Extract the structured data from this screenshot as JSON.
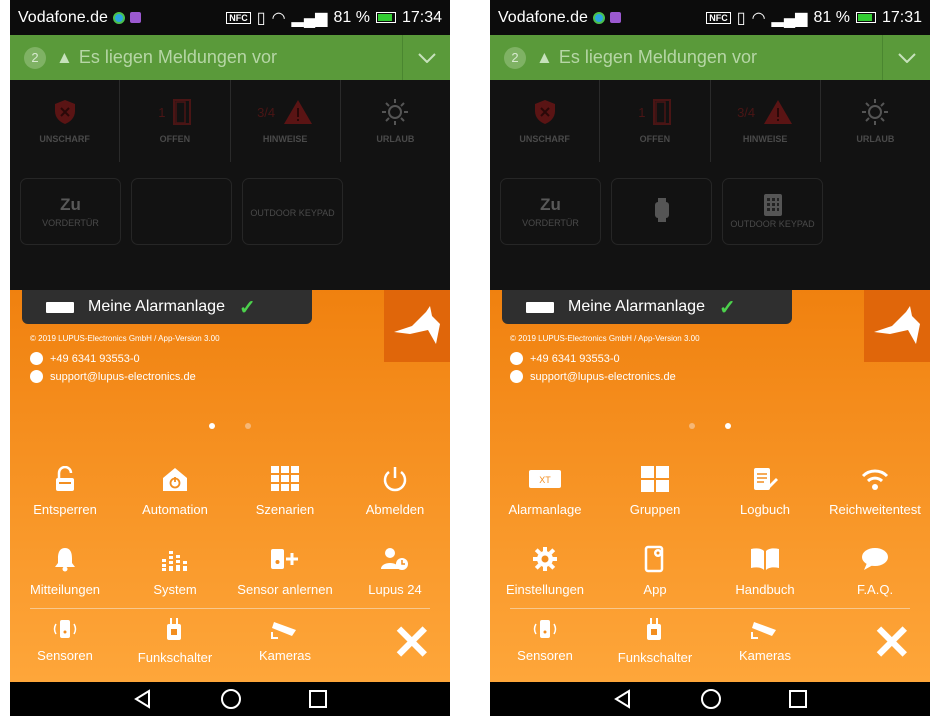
{
  "left": {
    "status_bar": {
      "carrier": "Vodafone.de",
      "nfc": "NFC",
      "battery": "81 %",
      "time": "17:34"
    },
    "banner": {
      "count": "2",
      "text": "Es liegen Meldungen vor"
    },
    "status": [
      {
        "label": "UNSCHARF",
        "value": ""
      },
      {
        "label": "OFFEN",
        "value": "1"
      },
      {
        "label": "HINWEISE",
        "value": "3/4"
      },
      {
        "label": "URLAUB",
        "value": ""
      }
    ],
    "tiles": [
      {
        "big": "Zu",
        "small": "VORDERTÜR"
      },
      {
        "big": "",
        "small": ""
      },
      {
        "big": "",
        "small": "OUTDOOR KEYPAD"
      }
    ],
    "alarm": "Meine Alarmanlage",
    "copyright": "© 2019 LUPUS-Electronics GmbH / App-Version 3.00",
    "phone": "+49 6341 93553-0",
    "email": "support@lupus-electronics.de",
    "menu": [
      "Entsperren",
      "Automation",
      "Szenarien",
      "Abmelden",
      "Mitteilungen",
      "System",
      "Sensor anlernen",
      "Lupus 24"
    ],
    "bottom": [
      "Sensoren",
      "Funkschalter",
      "Kameras"
    ]
  },
  "right": {
    "status_bar": {
      "carrier": "Vodafone.de",
      "nfc": "NFC",
      "battery": "81 %",
      "time": "17:31"
    },
    "banner": {
      "count": "2",
      "text": "Es liegen Meldungen vor"
    },
    "status": [
      {
        "label": "UNSCHARF",
        "value": ""
      },
      {
        "label": "OFFEN",
        "value": "1"
      },
      {
        "label": "HINWEISE",
        "value": "3/4"
      },
      {
        "label": "URLAUB",
        "value": ""
      }
    ],
    "tiles": [
      {
        "big": "Zu",
        "small": "VORDERTÜR"
      },
      {
        "big": "",
        "small": ""
      },
      {
        "big": "",
        "small": "OUTDOOR KEYPAD"
      }
    ],
    "alarm": "Meine Alarmanlage",
    "copyright": "© 2019 LUPUS-Electronics GmbH / App-Version 3.00",
    "phone": "+49 6341 93553-0",
    "email": "support@lupus-electronics.de",
    "menu": [
      "Alarmanlage",
      "Gruppen",
      "Logbuch",
      "Reichweitentest",
      "Einstellungen",
      "App",
      "Handbuch",
      "F.A.Q."
    ],
    "xt_badge": "XT",
    "bottom": [
      "Sensoren",
      "Funkschalter",
      "Kameras"
    ]
  },
  "colors": {
    "banner": "#5a9a3a",
    "orange_top": "#f0810f",
    "orange_bottom": "#fea63a",
    "dark": "#121212",
    "check": "#4cd14c"
  }
}
